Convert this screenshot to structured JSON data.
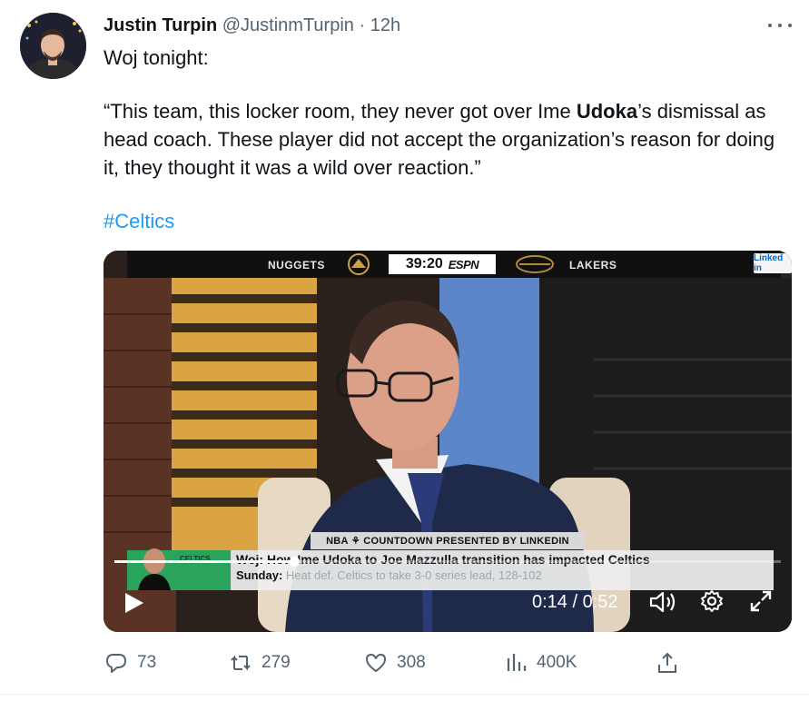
{
  "tweet": {
    "author_name": "Justin Turpin",
    "author_handle": "@JustinmTurpin",
    "separator": "·",
    "time": "12h",
    "line1": "Woj tonight:",
    "quote_open": "“This team, this locker room, they never got over Ime ",
    "quote_bold": "Udoka",
    "quote_rest": "’s dismissal as head coach. These player did not accept the organization’s reason for doing it, they thought it was a wild over reaction.”",
    "hashtag": "#Celtics"
  },
  "video": {
    "scoreboard": {
      "team_left": "NUGGETS",
      "clock": "39:20",
      "network": "ESPN",
      "team_right": "LAKERS",
      "sponsor": "Linked in"
    },
    "countdown_banner": "NBA ⚘ COUNTDOWN PRESENTED BY LINKEDIN",
    "side_text": "CELTICS",
    "headline": "Woj: How Ime Udoka to Joe Mazzulla transition has impacted Celtics",
    "sub_label": "Sunday:",
    "sub_text": "Heat def. Celtics to take 3-0 series lead, 128-102",
    "time_display": "0:14 / 0:52",
    "progress_fraction": 0.27
  },
  "actions": {
    "replies": "73",
    "retweets": "279",
    "likes": "308",
    "views": "400K"
  },
  "icons": {
    "more": "more-dots-icon",
    "reply": "reply-icon",
    "retweet": "retweet-icon",
    "like": "heart-icon",
    "views": "views-chart-icon",
    "share": "share-icon",
    "play": "play-icon",
    "volume": "volume-icon",
    "settings": "gear-icon",
    "fullscreen": "expand-icon"
  },
  "colors": {
    "text": "#0f1419",
    "secondary": "#536471",
    "link": "#1d9bf0",
    "lower_third_green": "#2aa35c"
  }
}
